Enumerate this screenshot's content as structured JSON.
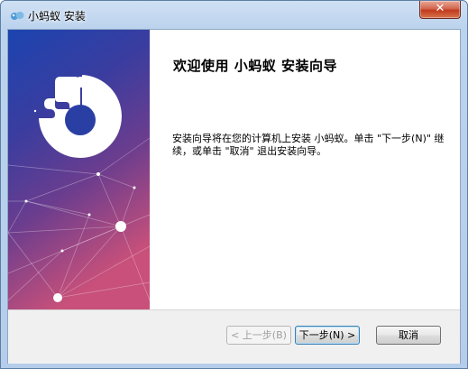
{
  "window": {
    "title": "小蚂蚁 安装",
    "close_label": "✕"
  },
  "content": {
    "heading": "欢迎使用 小蚂蚁 安装向导",
    "description": "安装向导将在您的计算机上安装 小蚂蚁。单击 \"下一步(N)\" 继续，或单击 \"取消\" 退出安装向导。"
  },
  "buttons": {
    "back": "< 上一步(B)",
    "next": "下一步(N) >",
    "cancel": "取消"
  },
  "colors": {
    "banner_top": "#1d3fa8",
    "banner_mid": "#4a3a9e",
    "banner_bottom": "#d6506f"
  }
}
